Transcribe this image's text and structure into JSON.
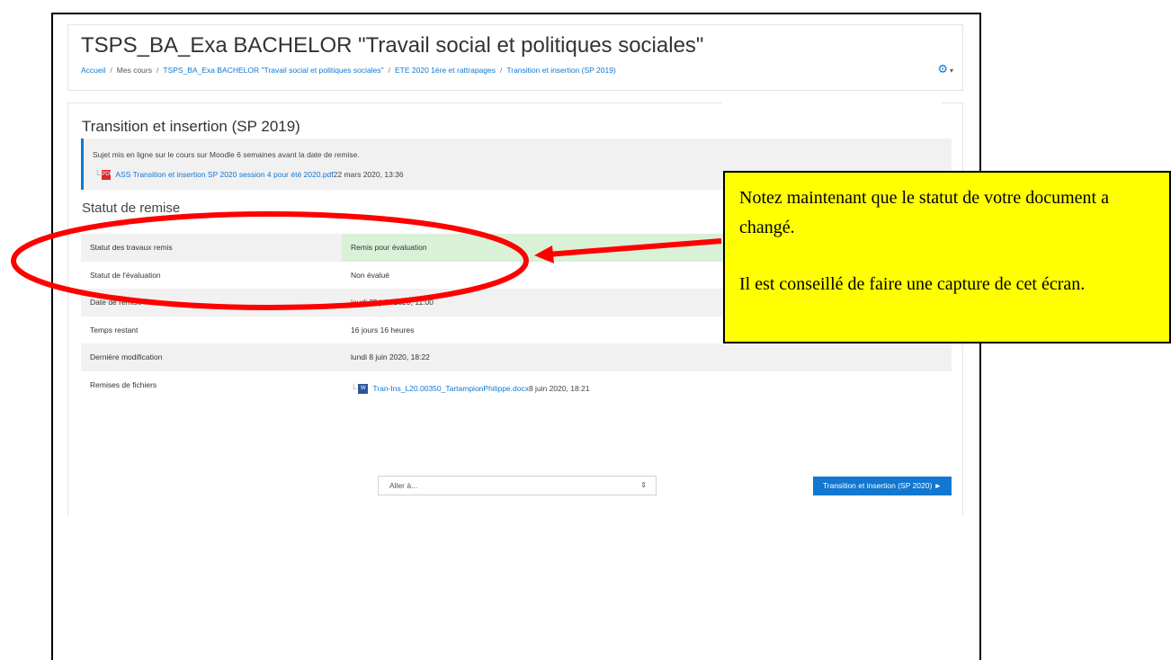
{
  "header": {
    "title": "TSPS_BA_Exa BACHELOR \"Travail social et politiques sociales\"",
    "breadcrumb": [
      "Accueil",
      "Mes cours",
      "TSPS_BA_Exa BACHELOR \"Travail social et politiques sociales\"",
      "ETE 2020 1ère et rattrapages",
      "Transition et insertion (SP 2019)"
    ],
    "breadcrumb_separator": "/",
    "settings_icon": "gear-icon"
  },
  "activity": {
    "title": "Transition et insertion (SP 2019)",
    "intro_text": "Sujet mis en ligne sur le cours sur Moodle 6 semaines avant la date de remise.",
    "attachment_name": "ASS Transition et insertion SP 2020 session 4 pour été 2020.pdf",
    "attachment_date": "22 mars 2020, 13:36"
  },
  "submission_status": {
    "section_title": "Statut de remise",
    "rows": [
      {
        "label": "Statut des travaux remis",
        "value": "Remis pour évaluation"
      },
      {
        "label": "Statut de l'évaluation",
        "value": "Non évalué"
      },
      {
        "label": "Date de remise",
        "value": "jeudi 25 juin 2020, 11:00"
      },
      {
        "label": "Temps restant",
        "value": "16 jours 16 heures"
      },
      {
        "label": "Dernière modification",
        "value": "lundi 8 juin 2020, 18:22"
      }
    ],
    "files_label": "Remises de fichiers",
    "file_name": "Tran-Ins_L20.00350_TartampionPhilippe.docx",
    "file_date": "8 juin 2020, 18:21",
    "submitted_color": "#d9f1d7"
  },
  "footer_nav": {
    "goto_selected": "Aller à...",
    "next_button": "Transition et insertion (SP 2020) ►"
  },
  "callout": {
    "line1": "Notez maintenant que le statut de votre document a changé.",
    "line2": "Il est conseillé de faire une capture de cet écran.",
    "background": "#ffff00"
  },
  "colors": {
    "link": "#1177d1",
    "annotation": "#ff0000"
  }
}
